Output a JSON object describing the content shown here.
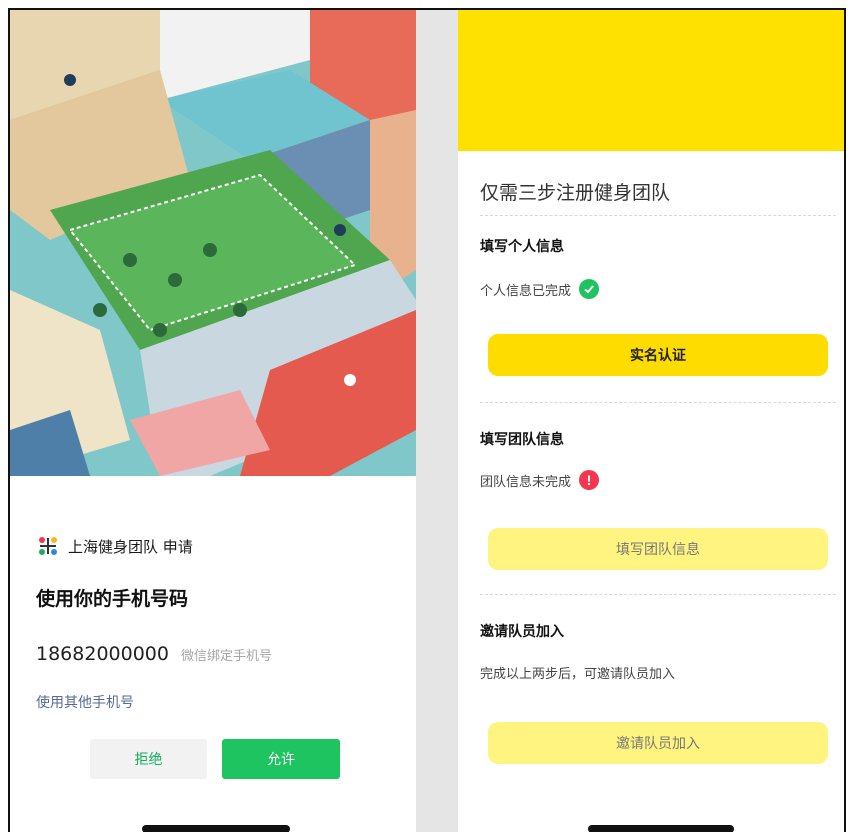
{
  "left": {
    "app_name": "上海健身团队 申请",
    "heading": "使用你的手机号码",
    "phone_number": "18682000000",
    "phone_hint": "微信绑定手机号",
    "other_phone_link": "使用其他手机号",
    "reject_label": "拒绝",
    "allow_label": "允许"
  },
  "right": {
    "title": "仅需三步注册健身团队",
    "step1": {
      "heading": "填写个人信息",
      "status": "个人信息已完成",
      "status_icon": "check-circle-icon",
      "button": "实名认证"
    },
    "step2": {
      "heading": "填写团队信息",
      "status": "团队信息未完成",
      "status_icon": "exclamation-circle-icon",
      "button": "填写团队信息"
    },
    "step3": {
      "heading": "邀请队员加入",
      "status": "完成以上两步后，可邀请队员加入",
      "button": "邀请队员加入"
    }
  },
  "colors": {
    "accent_yellow": "#ffdc00",
    "disabled_yellow": "#fff480",
    "wechat_green": "#1ec45f",
    "link_blue": "#576b95",
    "error_red": "#f5364f"
  }
}
